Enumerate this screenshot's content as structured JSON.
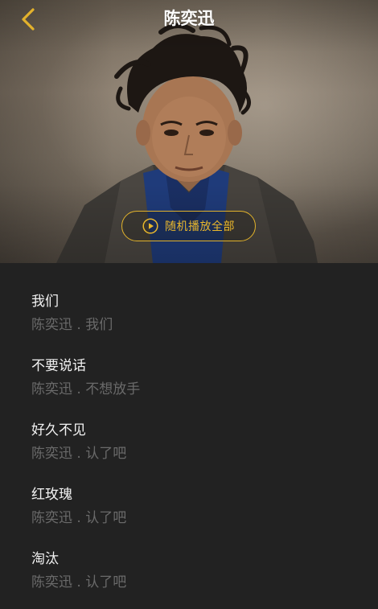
{
  "header": {
    "title": "陈奕迅"
  },
  "hero": {
    "play_all_label": "随机播放全部"
  },
  "colors": {
    "accent": "#e9b72c",
    "background": "#222222",
    "song_title": "#f2f2f2",
    "song_meta": "#6a6a6a"
  },
  "icons": {
    "back": "chevron-left-icon",
    "play": "play-circle-icon"
  },
  "songs": [
    {
      "title": "我们",
      "meta": "陈奕迅 . 我们"
    },
    {
      "title": "不要说话",
      "meta": "陈奕迅 . 不想放手"
    },
    {
      "title": "好久不见",
      "meta": "陈奕迅 . 认了吧"
    },
    {
      "title": "红玫瑰",
      "meta": "陈奕迅 . 认了吧"
    },
    {
      "title": "淘汰",
      "meta": "陈奕迅 . 认了吧"
    }
  ]
}
